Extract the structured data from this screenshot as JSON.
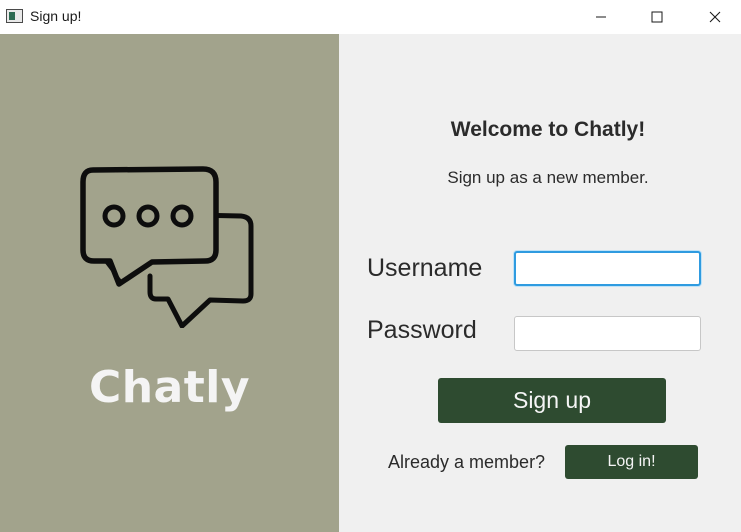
{
  "window": {
    "title": "Sign up!",
    "controls": {
      "minimize": "minimize-icon",
      "maximize": "maximize-icon",
      "close": "close-icon"
    }
  },
  "branding": {
    "logo_icon": "chat-bubbles-icon",
    "app_name": "Chatly"
  },
  "form": {
    "heading": "Welcome to Chatly!",
    "subheading": "Sign up as a new member.",
    "username_label": "Username",
    "username_value": "",
    "password_label": "Password",
    "password_value": "",
    "signup_label": "Sign up",
    "member_prompt": "Already a member?",
    "login_label": "Log in!"
  },
  "colors": {
    "left_panel": "#a2a38c",
    "right_panel": "#f0f0f0",
    "button": "#2e4b30",
    "focus_ring": "#2f9be0"
  }
}
